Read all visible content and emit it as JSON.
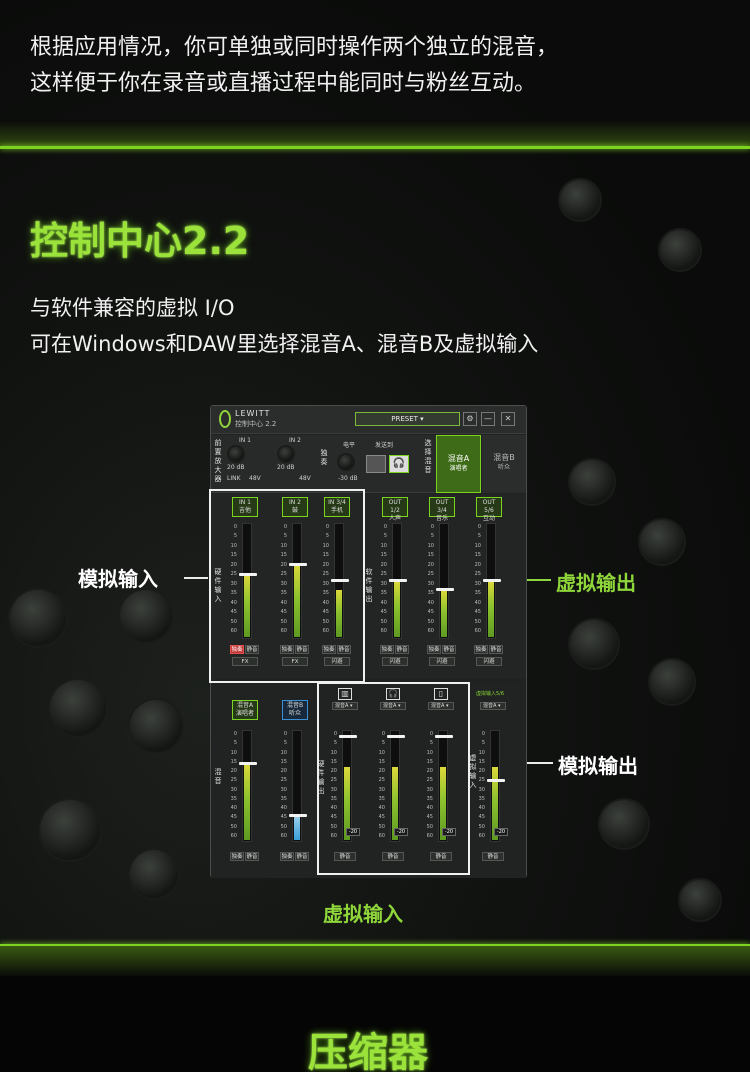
{
  "intro": {
    "line1": "根据应用情况，你可单独或同时操作两个独立的混音，",
    "line2": "这样便于你在录音或直播过程中能同时与粉丝互动。"
  },
  "section1": {
    "title": "控制中心2.2",
    "desc1": "与软件兼容的虚拟 I/O",
    "desc2": "可在Windows和DAW里选择混音A、混音B及虚拟输入"
  },
  "section2": {
    "title": "压缩器"
  },
  "callouts": {
    "analog_input": "模拟输入",
    "virtual_output": "虚拟输出",
    "analog_output": "模拟输出",
    "virtual_input": "虚拟输入"
  },
  "app": {
    "brand": "LEWITT",
    "name": "控制中心 2.2",
    "preset": "PRESET",
    "preamp_label": "前置放大器",
    "in1_small": "IN 1",
    "in2_small": "IN 2",
    "gain_20db": "20 dB",
    "link": "LINK",
    "phantom": "48V",
    "solo_v": "独奏",
    "level": "电平",
    "level_db": "-30 dB",
    "send_to": "发送到",
    "select_mix": "选择混音",
    "mixA": "混音A",
    "mixA_sub": "演唱者",
    "mixB": "混音B",
    "mixB_sub": "听众",
    "hw_input": "硬件输入",
    "sw_output": "软件输出",
    "mix_v": "混音",
    "hw_output": "硬件输出",
    "v_input": "虚拟输入"
  },
  "scale": [
    "0",
    "5",
    "10",
    "15",
    "20",
    "25",
    "30",
    "35",
    "40",
    "45",
    "50",
    "60"
  ],
  "top_channels": [
    {
      "l1": "IN 1",
      "l2": "吉他",
      "level": 0.55,
      "fader": 0.55,
      "b1": "独奏",
      "b1red": true,
      "b2": "静音",
      "fx": "FX"
    },
    {
      "l1": "IN 2",
      "l2": "鼓",
      "level": 0.64,
      "fader": 0.64,
      "b1": "独奏",
      "b1red": false,
      "b2": "静音",
      "fx": "FX"
    },
    {
      "l1": "IN 3/4",
      "l2": "手机",
      "level": 0.42,
      "fader": 0.5,
      "b1": "独奏",
      "b1red": false,
      "b2": "静音",
      "fx": "闪避"
    },
    {
      "l1": "OUT 1/2",
      "l2": "人声",
      "level": 0.5,
      "fader": 0.5,
      "b1": "独奏",
      "b1red": false,
      "b2": "静音",
      "fx": "闪避"
    },
    {
      "l1": "OUT 3/4",
      "l2": "音乐",
      "level": 0.42,
      "fader": 0.42,
      "b1": "独奏",
      "b1red": false,
      "b2": "静音",
      "fx": "闪避"
    },
    {
      "l1": "OUT 5/6",
      "l2": "互动",
      "level": 0.5,
      "fader": 0.5,
      "b1": "独奏",
      "b1red": false,
      "b2": "静音",
      "fx": "闪避"
    }
  ],
  "bottom_channels": [
    {
      "l1": "混音A",
      "l2": "演唱者",
      "level": 0.7,
      "fader": 0.7,
      "b1": "独奏",
      "b2": "静音",
      "blue": false
    },
    {
      "l1": "混音B",
      "l2": "听众",
      "level": 0.22,
      "fader": 0.22,
      "b1": "独奏",
      "b2": "静音",
      "blue": true
    },
    {
      "icon": "speaker-icon",
      "dd": "混音A",
      "level": 0.68,
      "fader": 0.95,
      "b2": "静音",
      "gain": "-20"
    },
    {
      "icon": "headphones-icon",
      "dd": "混音A",
      "level": 0.68,
      "fader": 0.95,
      "b2": "静音",
      "gain": "-20"
    },
    {
      "icon": "phone-icon",
      "dd": "混音A",
      "level": 0.68,
      "fader": 0.95,
      "b2": "静音",
      "gain": "-20"
    },
    {
      "top": "虚拟输入5/6",
      "dd": "混音A",
      "level": 0.68,
      "fader": 0.55,
      "b2": "静音",
      "gain": "-20"
    }
  ]
}
